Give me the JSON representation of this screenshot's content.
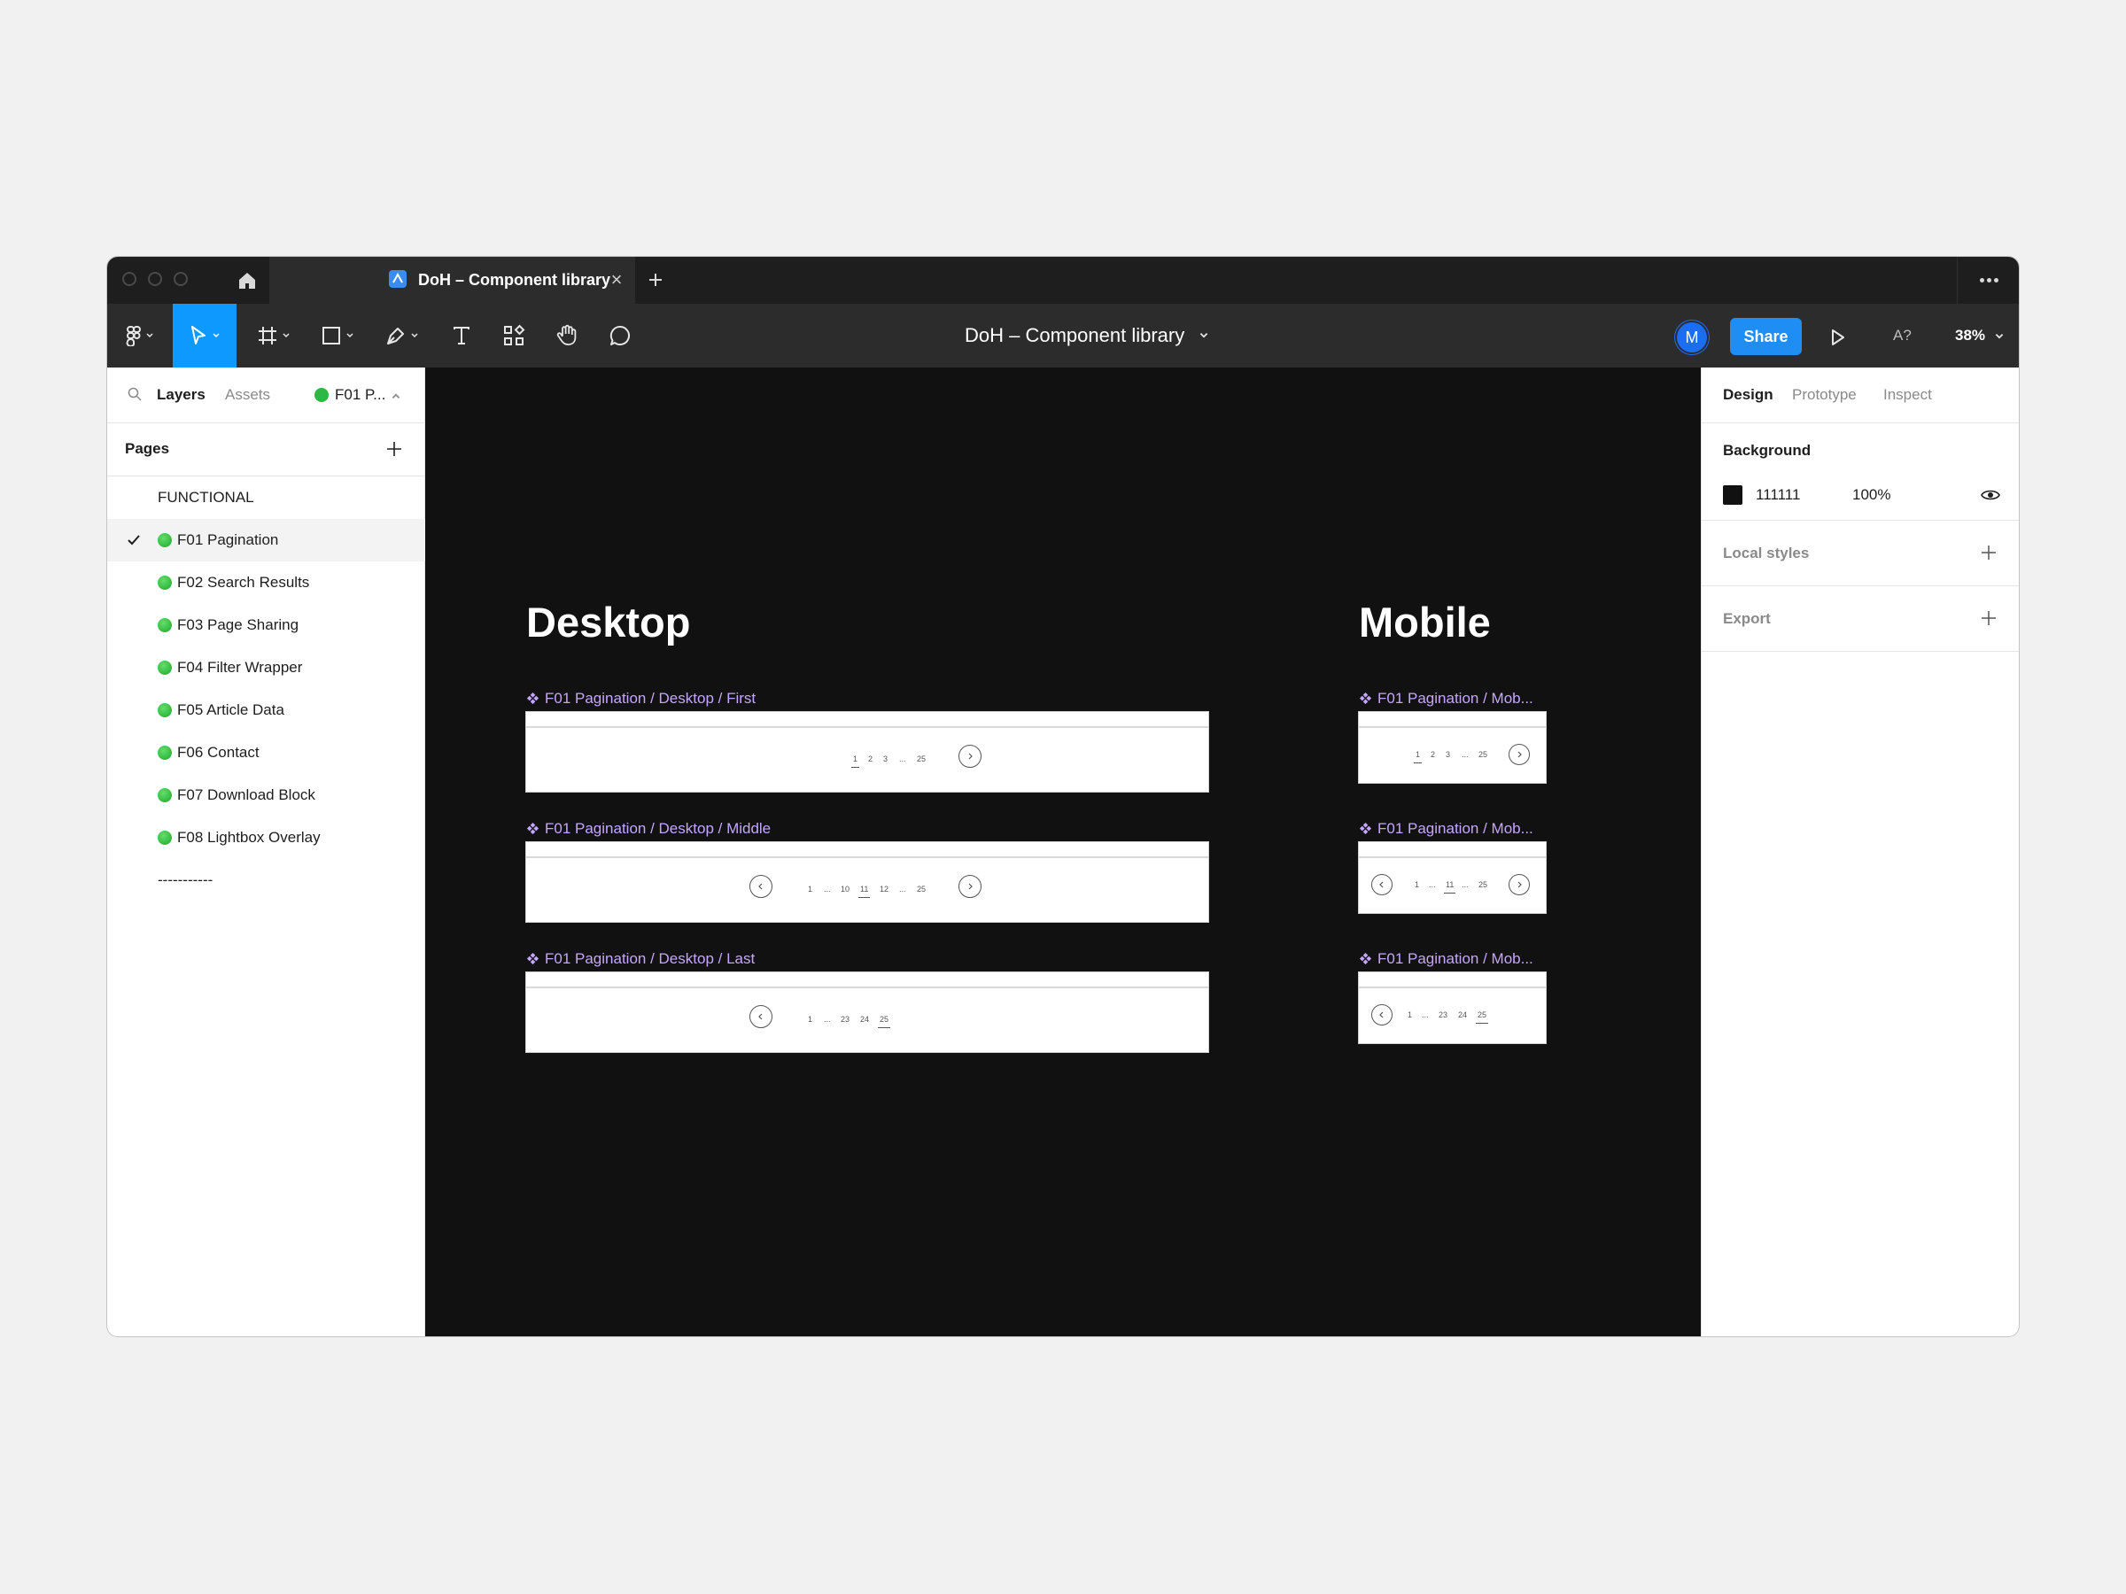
{
  "titlebar": {
    "tab_title": "DoH – Component library",
    "tab_close": "×"
  },
  "toolbar": {
    "doc_title": "DoH – Component library",
    "avatar_initial": "M",
    "share_label": "Share",
    "missing_fonts_label": "A?",
    "zoom": "38%"
  },
  "left_panel": {
    "tabs": {
      "layers": "Layers",
      "assets": "Assets",
      "current_page": "F01 P..."
    },
    "pages_title": "Pages",
    "pages": [
      {
        "label": "FUNCTIONAL",
        "dot": false,
        "active": false
      },
      {
        "label": "F01 Pagination",
        "dot": true,
        "active": true
      },
      {
        "label": "F02 Search Results",
        "dot": true,
        "active": false
      },
      {
        "label": "F03 Page Sharing",
        "dot": true,
        "active": false
      },
      {
        "label": "F04 Filter Wrapper",
        "dot": true,
        "active": false
      },
      {
        "label": "F05 Article Data",
        "dot": true,
        "active": false
      },
      {
        "label": "F06 Contact",
        "dot": true,
        "active": false
      },
      {
        "label": "F07 Download Block",
        "dot": true,
        "active": false
      },
      {
        "label": "F08 Lightbox Overlay",
        "dot": true,
        "active": false
      },
      {
        "label": "-----------",
        "dot": false,
        "active": false
      }
    ]
  },
  "canvas": {
    "background": "#111111",
    "sections": {
      "desktop": "Desktop",
      "mobile": "Mobile"
    },
    "frames": {
      "desktop_first": {
        "label": "F01 Pagination / Desktop / First",
        "pages": [
          "1",
          "2",
          "3",
          "...",
          "25"
        ]
      },
      "desktop_middle": {
        "label": "F01 Pagination / Desktop / Middle",
        "pages": [
          "1",
          "...",
          "10",
          "11",
          "12",
          "...",
          "25"
        ]
      },
      "desktop_last": {
        "label": "F01 Pagination / Desktop / Last",
        "pages": [
          "1",
          "...",
          "23",
          "24",
          "25"
        ]
      },
      "mobile_first": {
        "label": "F01 Pagination / Mob...",
        "pages": [
          "1",
          "2",
          "3",
          "...",
          "25"
        ]
      },
      "mobile_middle": {
        "label": "F01 Pagination / Mob...",
        "pages": [
          "1",
          "...",
          "11",
          "...",
          "25"
        ]
      },
      "mobile_last": {
        "label": "F01 Pagination / Mob...",
        "pages": [
          "1",
          "...",
          "23",
          "24",
          "25"
        ]
      }
    },
    "component_label_color": "#c5a6ff"
  },
  "right_panel": {
    "tabs": {
      "design": "Design",
      "prototype": "Prototype",
      "inspect": "Inspect"
    },
    "background": {
      "title": "Background",
      "hex": "111111",
      "opacity": "100%"
    },
    "local_styles": "Local styles",
    "export": "Export"
  },
  "colors": {
    "accent": "#0d99ff",
    "share": "#1e8ef5",
    "page_dot": "#2db744"
  }
}
